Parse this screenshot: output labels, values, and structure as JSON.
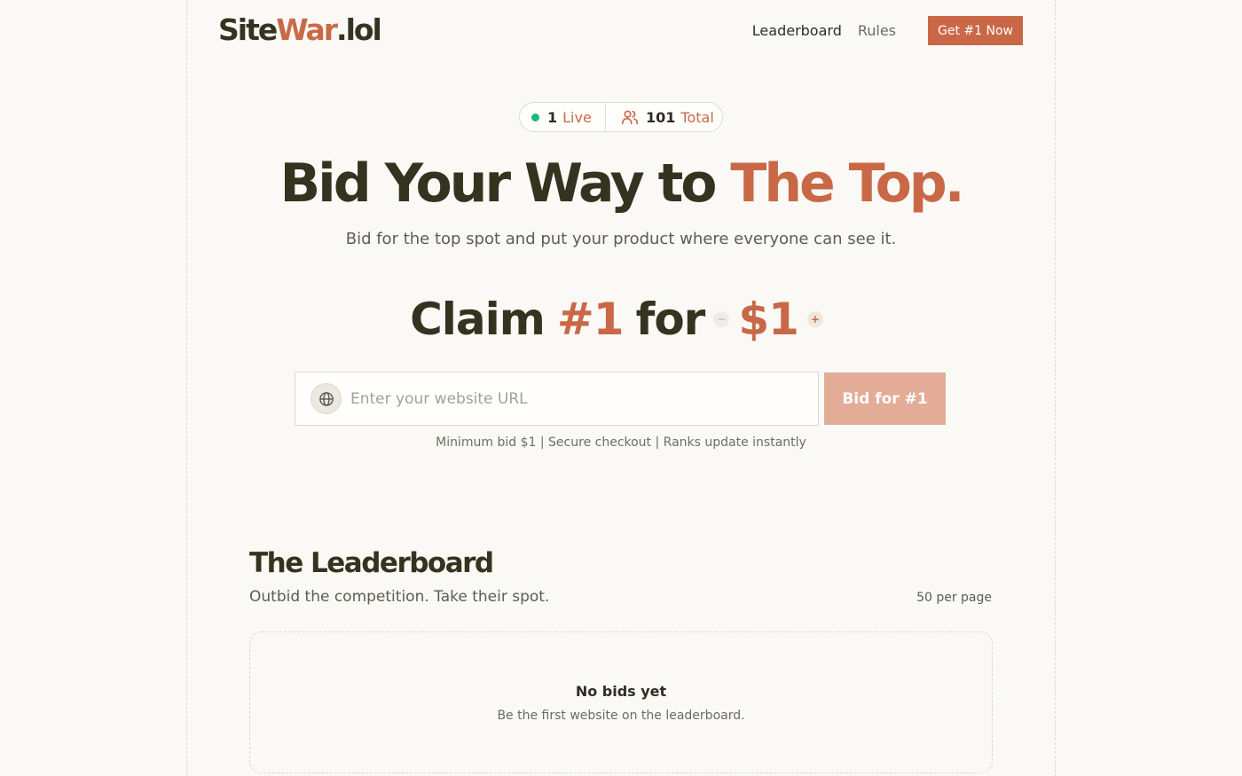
{
  "header": {
    "logo_part1": "Site",
    "logo_part2": "War",
    "logo_part3": ".lol",
    "nav": {
      "leaderboard": "Leaderboard",
      "rules": "Rules"
    },
    "cta_label": "Get #1 Now"
  },
  "stats": {
    "live_count": "1",
    "live_label": "Live",
    "total_count": "101",
    "total_label": "Total"
  },
  "hero": {
    "title_main": "Bid Your Way to ",
    "title_accent": "The Top.",
    "subtitle": "Bid for the top spot and put your product where everyone can see it."
  },
  "claim": {
    "word": "Claim",
    "rank": "#1",
    "for_word": "for",
    "amount": "$1",
    "minus_label": "−",
    "plus_label": "+"
  },
  "bid_form": {
    "url_placeholder": "Enter your website URL",
    "url_value": "",
    "submit_label": "Bid for #1",
    "fineprint": "Minimum bid $1 | Secure checkout | Ranks update instantly"
  },
  "leaderboard": {
    "title": "The Leaderboard",
    "subtitle": "Outbid the competition. Take their spot.",
    "per_page": "50 per page",
    "empty_title": "No bids yet",
    "empty_subtitle": "Be the first website on the leaderboard."
  },
  "colors": {
    "accent": "#c96847",
    "text": "#35331f",
    "background": "#faf9f6",
    "live_dot": "#1fb87c"
  }
}
